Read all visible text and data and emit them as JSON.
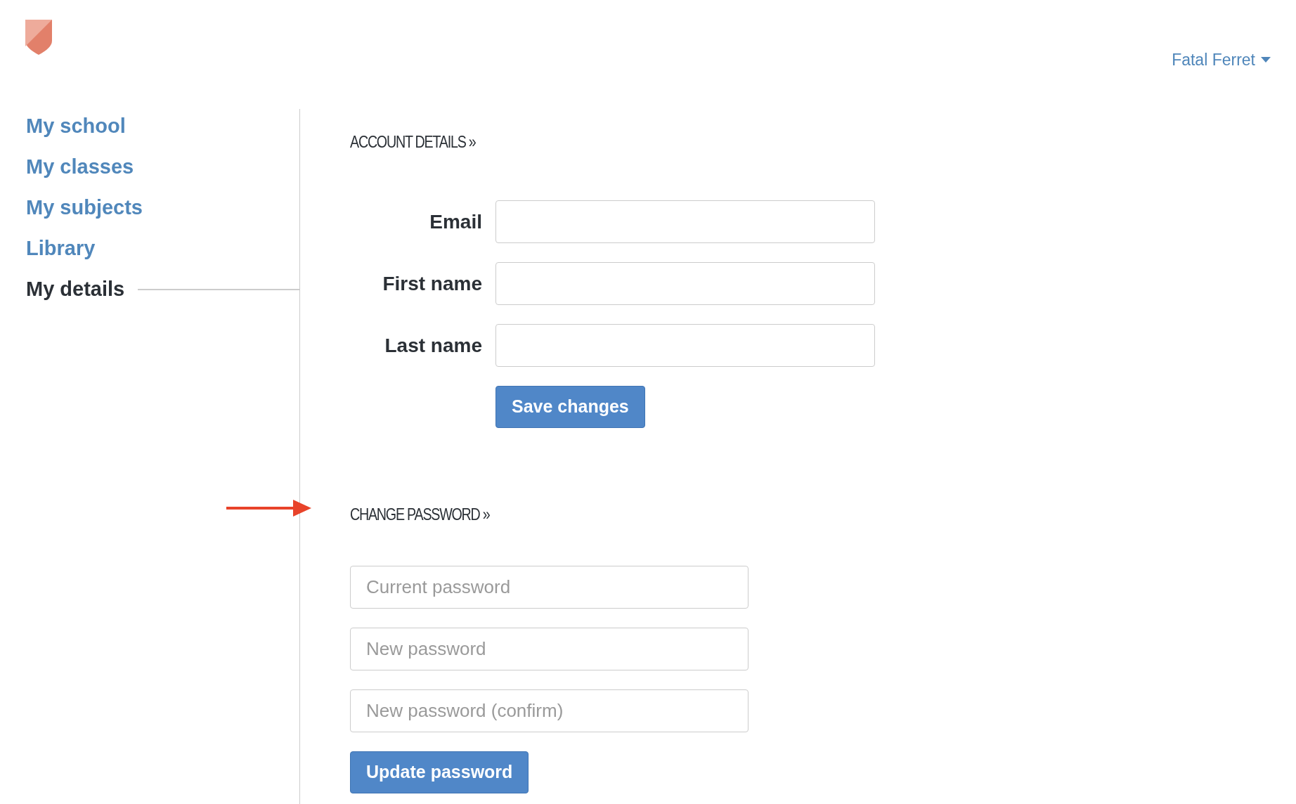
{
  "user_menu": {
    "label": "Fatal Ferret"
  },
  "sidebar": {
    "items": [
      {
        "label": "My school",
        "selected": false
      },
      {
        "label": "My classes",
        "selected": false
      },
      {
        "label": "My subjects",
        "selected": false
      },
      {
        "label": "Library",
        "selected": false
      },
      {
        "label": "My details",
        "selected": true
      }
    ]
  },
  "account_details": {
    "heading": "ACCOUNT DETAILS »",
    "fields": [
      {
        "label": "Email"
      },
      {
        "label": "First name"
      },
      {
        "label": "Last name"
      }
    ],
    "button": "Save changes"
  },
  "change_password": {
    "heading": "CHANGE PASSWORD »",
    "fields": [
      {
        "placeholder": "Current password"
      },
      {
        "placeholder": "New password"
      },
      {
        "placeholder": "New password (confirm)"
      }
    ],
    "button": "Update password"
  }
}
